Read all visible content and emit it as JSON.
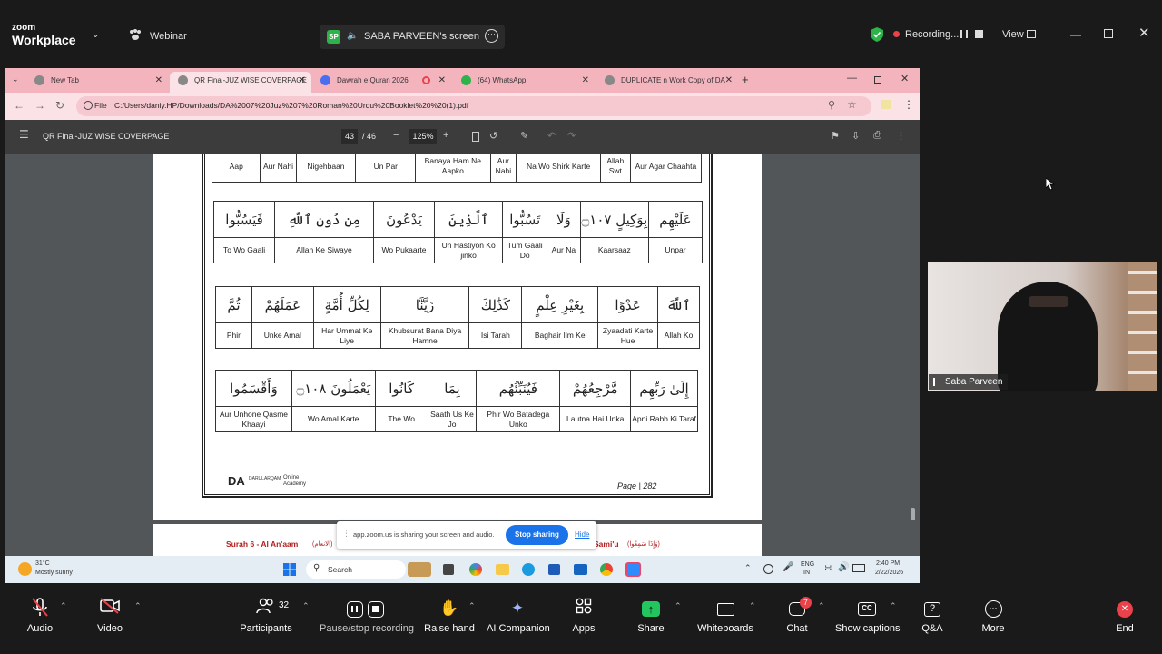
{
  "zoom": {
    "logo_small": "zoom",
    "logo_big": "Workplace",
    "webinar_label": "Webinar",
    "sharer_initials": "SP",
    "sharer_label": "SABA PARVEEN's screen",
    "recording_label": "Recording...",
    "view_label": "View"
  },
  "browser": {
    "tabs": [
      {
        "label": "New Tab",
        "color": "#888888"
      },
      {
        "label": "QR Final-JUZ WISE COVERPAGE",
        "color": "#888888"
      },
      {
        "label": "Dawrah e Quran 2026",
        "color": "#4a6ef0"
      },
      {
        "label": "(64) WhatsApp",
        "color": "#2eb34a",
        "badge": "64"
      },
      {
        "label": "DUPLICATE n Work Copy of DA",
        "color": "#888888"
      }
    ],
    "file_chip": "File",
    "url": "C:/Users/daniy.HP/Downloads/DA%2007%20Juz%207%20Roman%20Urdu%20Booklet%20%20(1).pdf"
  },
  "pdf": {
    "title": "QR Final-JUZ WISE COVERPAGE",
    "page_current": "43",
    "page_total": "/ 46",
    "zoom": "125%",
    "top_row": [
      "Aap",
      "Aur Nahi",
      "Nigehbaan",
      "Un Par",
      "Banaya Ham Ne Aapko",
      "Aur Nahi",
      "Na Wo Shirk Karte",
      "Allah Swt",
      "Aur Agar Chaahta"
    ],
    "table1": {
      "arabic": [
        "فَيَسُبُّوا",
        "مِن دُونِ ٱللَّهِ",
        "يَدْعُونَ",
        "ٱلَّذِينَ",
        "تَسُبُّوا",
        "وَلَا",
        "بِوَكِيلٍ ۝١٠٧",
        "عَلَيْهِم"
      ],
      "roman": [
        "To Wo Gaali",
        "Allah  Ke  Siwaye",
        "Wo Pukaarte",
        "Un Hastiyon Ko jinko",
        "Tum Gaali Do",
        "Aur Na",
        "Kaarsaaz",
        "Unpar"
      ]
    },
    "table2": {
      "arabic": [
        "ثُمَّ",
        "عَمَلَهُمْ",
        "لِكُلِّ أُمَّةٍ",
        "زَيَّنَّا",
        "كَذَٰلِكَ",
        "بِغَيْرِ عِلْمٍ",
        "عَدْوًا",
        "ٱللَّهَ"
      ],
      "roman": [
        "Phir",
        "Unke Amal",
        "Har Ummat Ke Liye",
        "Khubsurat Bana Diya Hamne",
        "Isi Tarah",
        "Baghair Ilm Ke",
        "Zyaadati Karte Hue",
        "Allah Ko"
      ]
    },
    "table3": {
      "arabic": [
        "وَأَقْسَمُوا",
        "يَعْمَلُونَ ۝١٠٨",
        "كَانُوا",
        "بِمَا",
        "فَيُنَبِّئُهُم",
        "مَّرْجِعُهُمْ",
        "إِلَىٰ رَبِّهِم"
      ],
      "roman": [
        "Aur Unhone Qasme Khaayi",
        "Wo Amal Karte",
        "The Wo",
        "Saath Us Ke Jo",
        "Phir Wo Batadega Unko",
        "Lautna Hai Unka",
        "Apni Rabb Ki Taraf"
      ]
    },
    "footer_logo": "DA",
    "footer_logo_text": "DARULARQAM",
    "footer_logo_sub": "Online Academy",
    "page_label": "Page | 282",
    "next_page_left": "Surah 6 - Al An'aam",
    "next_page_arabic": "(الانعام)",
    "next_page_right": "Sami'u",
    "next_page_right_arabic": "(وَإِذَا سَمِعُوا)"
  },
  "share_toast": {
    "text": "app.zoom.us is sharing your screen and audio.",
    "stop": "Stop sharing",
    "hide": "Hide"
  },
  "taskbar": {
    "weather_temp": "31°C",
    "weather_desc": "Mostly sunny",
    "search": "Search",
    "lang1": "ENG",
    "lang2": "IN",
    "time": "2:40 PM",
    "date": "2/22/2026"
  },
  "video": {
    "name": "Saba Parveen"
  },
  "controls": {
    "audio": "Audio",
    "video": "Video",
    "participants": "Participants",
    "participants_count": "32",
    "pause_recording": "Pause/stop recording",
    "raise_hand": "Raise hand",
    "ai_companion": "AI Companion",
    "apps": "Apps",
    "share": "Share",
    "whiteboards": "Whiteboards",
    "chat": "Chat",
    "chat_badge": "7",
    "captions": "Show captions",
    "qa": "Q&A",
    "more": "More",
    "end": "End"
  }
}
